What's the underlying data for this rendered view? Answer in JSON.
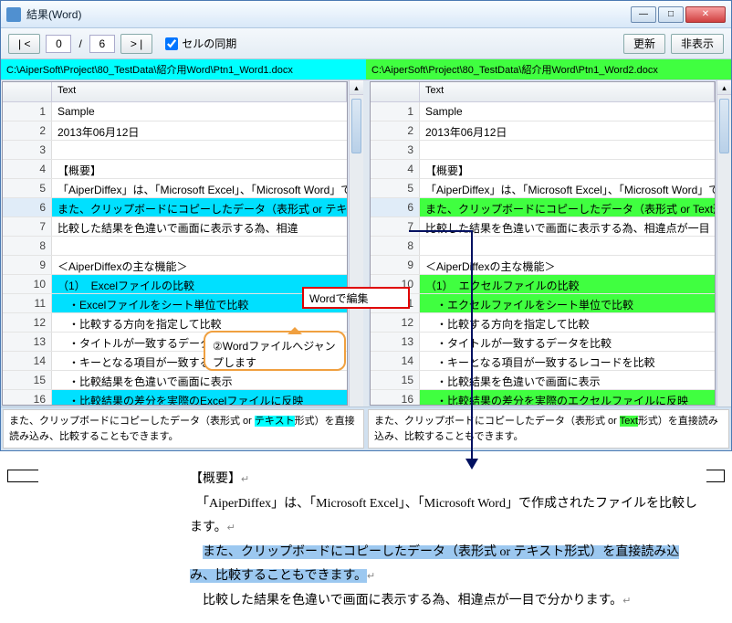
{
  "window": {
    "title": "結果(Word)"
  },
  "toolbar": {
    "prev": "| <",
    "cur": "0",
    "total": "6",
    "next": "> |",
    "sync_label": "セルの同期",
    "refresh": "更新",
    "hide": "非表示"
  },
  "paths": {
    "left": "C:\\AiperSoft\\Project\\80_TestData\\紹介用Word\\Ptn1_Word1.docx",
    "right": "C:\\AiperSoft\\Project\\80_TestData\\紹介用Word\\Ptn1_Word2.docx"
  },
  "header": {
    "col1": "",
    "col2": "Text"
  },
  "left_rows": [
    {
      "n": "1",
      "t": "Sample"
    },
    {
      "n": "2",
      "t": "2013年06月12日"
    },
    {
      "n": "3",
      "t": ""
    },
    {
      "n": "4",
      "t": "【概要】"
    },
    {
      "n": "5",
      "t": "「AiperDiffex」は、「Microsoft Excel」、「Microsoft Word」で…"
    },
    {
      "n": "6",
      "t": "また、クリップボードにコピーしたデータ（表形式 or テキスト形式）…",
      "cls": "hl-cyan sel"
    },
    {
      "n": "7",
      "t": "比較した結果を色違いで画面に表示する為、相違"
    },
    {
      "n": "8",
      "t": ""
    },
    {
      "n": "9",
      "t": "＜AiperDiffexの主な機能＞"
    },
    {
      "n": "10",
      "t": "（1）　Excelファイルの比較",
      "cls": "hl-cyan"
    },
    {
      "n": "11",
      "t": "　・Excelファイルをシート単位で比較",
      "cls": "hl-cyan"
    },
    {
      "n": "12",
      "t": "　・比較する方向を指定して比較"
    },
    {
      "n": "13",
      "t": "　・タイトルが一致するデータを比較"
    },
    {
      "n": "14",
      "t": "　・キーとなる項目が一致するレコードを比較"
    },
    {
      "n": "15",
      "t": "　・比較結果を色違いで画面に表示"
    },
    {
      "n": "16",
      "t": "　・比較結果の差分を実際のExcelファイルに反映",
      "cls": "hl-cyan"
    }
  ],
  "right_rows": [
    {
      "n": "1",
      "t": "Sample"
    },
    {
      "n": "2",
      "t": "2013年06月12日"
    },
    {
      "n": "3",
      "t": ""
    },
    {
      "n": "4",
      "t": "【概要】"
    },
    {
      "n": "5",
      "t": "「AiperDiffex」は、「Microsoft Excel」、「Microsoft Word」で…"
    },
    {
      "n": "6",
      "t": "また、クリップボードにコピーしたデータ（表形式 or Text形式）…",
      "cls": "hl-green sel"
    },
    {
      "n": "7",
      "t": "比較した結果を色違いで画面に表示する為、相違点が一目"
    },
    {
      "n": "8",
      "t": ""
    },
    {
      "n": "9",
      "t": "＜AiperDiffexの主な機能＞"
    },
    {
      "n": "10",
      "t": "（1）　エクセルファイルの比較",
      "cls": "hl-green"
    },
    {
      "n": "11",
      "t": "　・エクセルファイルをシート単位で比較",
      "cls": "hl-green"
    },
    {
      "n": "12",
      "t": "　・比較する方向を指定して比較"
    },
    {
      "n": "13",
      "t": "　・タイトルが一致するデータを比較"
    },
    {
      "n": "14",
      "t": "　・キーとなる項目が一致するレコードを比較"
    },
    {
      "n": "15",
      "t": "　・比較結果を色違いで画面に表示"
    },
    {
      "n": "16",
      "t": "　・比較結果の差分を実際のエクセルファイルに反映",
      "cls": "hl-green"
    }
  ],
  "context_menu": {
    "item1": "Wordで編集"
  },
  "callout": {
    "text": "②Wordファイルへジャンプします"
  },
  "bottom": {
    "left_pre": "また、クリップボードにコピーしたデータ（表形式 or ",
    "left_hl": "テキスト",
    "left_post": "形式）を直接読み込み、比較することもできます。",
    "right_pre": "また、クリップボードにコピーしたデータ（表形式 or ",
    "right_hl": "Text",
    "right_post": "形式）を直接読み込み、比較することもできます。"
  },
  "doc": {
    "l1": "【概要】",
    "l2": "「AiperDiffex」は、「Microsoft Excel」、「Microsoft Word」で作成されたファイルを比較します。",
    "l3": "また、クリップボードにコピーしたデータ（表形式 or テキスト形式）を直接読み込み、比較することもできます。",
    "l4": "比較した結果を色違いで画面に表示する為、相違点が一目で分かります。",
    "ret": "↵"
  }
}
